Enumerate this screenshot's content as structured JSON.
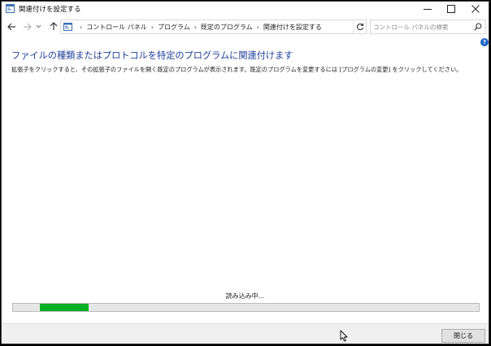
{
  "window": {
    "title": "関連付けを設定する"
  },
  "address_bar": {
    "crumbs": [
      "コントロール パネル",
      "プログラム",
      "既定のプログラム",
      "関連付けを設定する"
    ]
  },
  "search": {
    "placeholder": "コントロール パネルの検索"
  },
  "help": {
    "label": "?"
  },
  "content": {
    "heading": "ファイルの種類またはプロトコルを特定のプログラムに関連付けます",
    "description": "拡張子をクリックすると、その拡張子のファイルを開く既定のプログラムが表示されます。既定のプログラムを変更するには [プログラムの変更] をクリックしてください。",
    "loading_text": "読み込み中..."
  },
  "progress": {
    "segment_start": 0.058,
    "segment_end": 0.162,
    "color": "#06b025"
  },
  "footer": {
    "close_label": "閉じる"
  },
  "colors": {
    "heading": "#1e3f9a",
    "help_icon": "#1c63c4"
  }
}
